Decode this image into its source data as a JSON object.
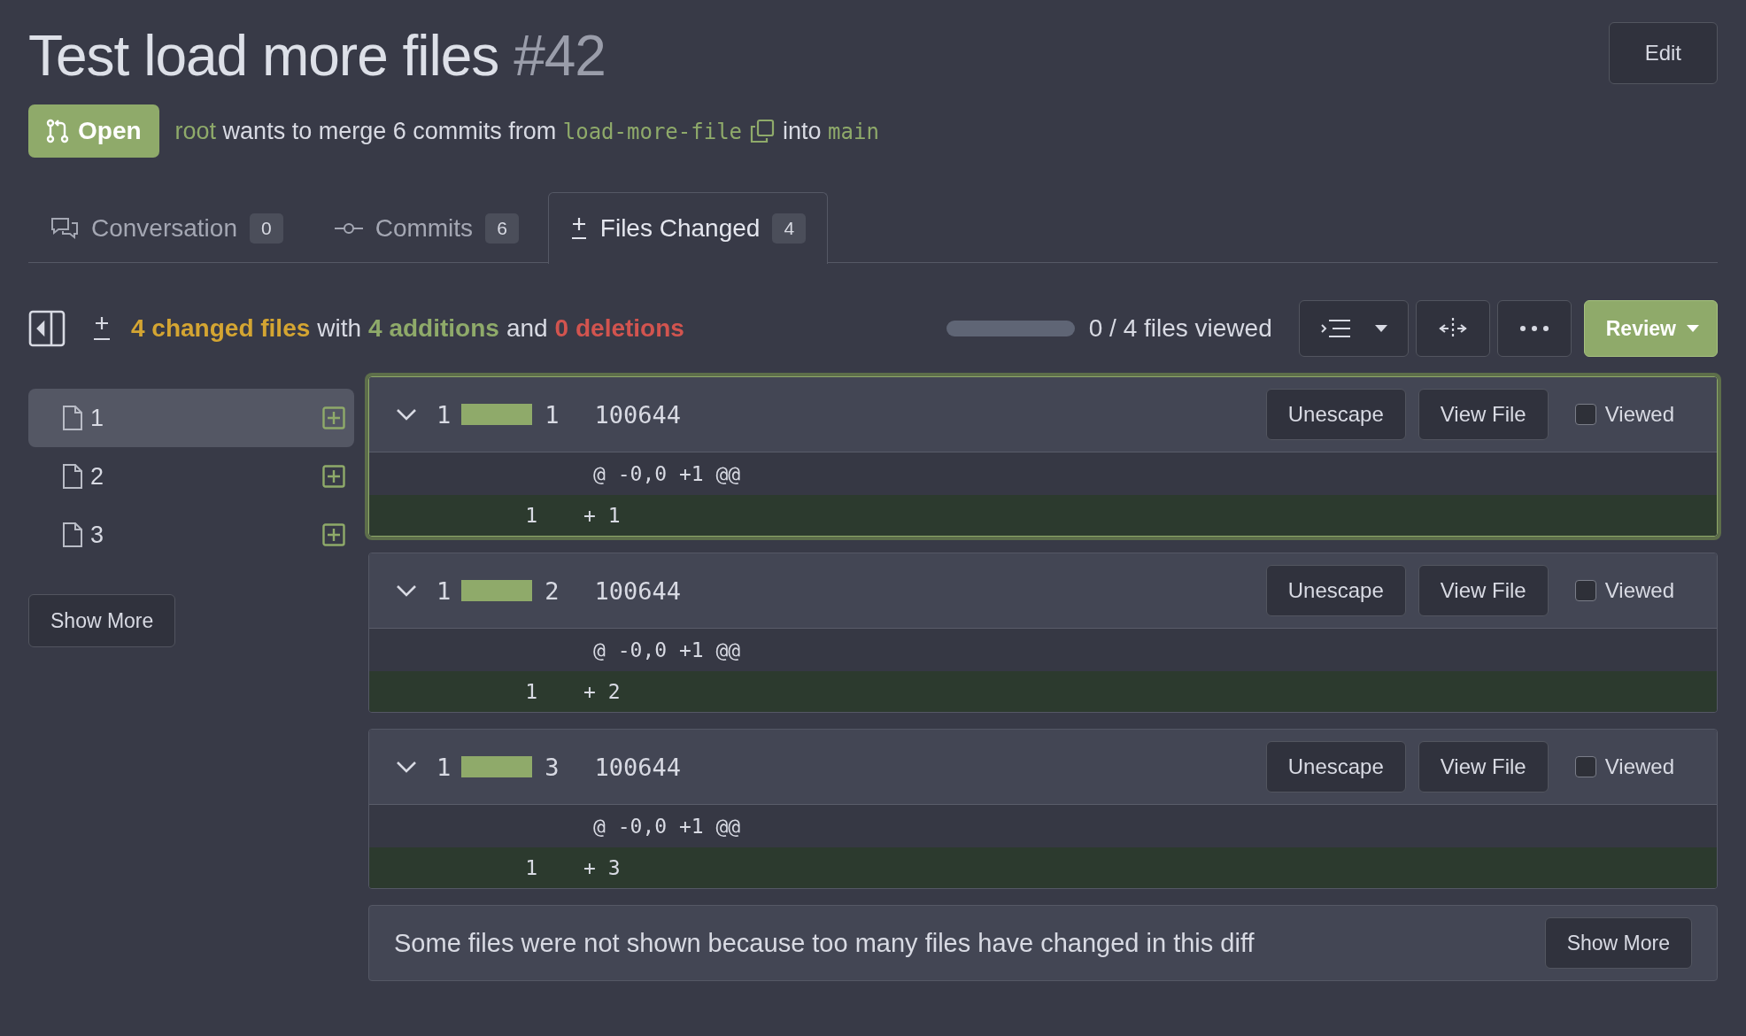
{
  "title": {
    "text": "Test load more files",
    "number": "#42"
  },
  "edit_button": "Edit",
  "status": {
    "label": "Open",
    "author": "root",
    "text_before": "wants to merge 6 commits from",
    "head_branch": "load-more-file",
    "text_middle": "into",
    "base_branch": "main"
  },
  "tabs": [
    {
      "kind": "conversation",
      "label": "Conversation",
      "count": "0",
      "selected": false
    },
    {
      "kind": "commits",
      "label": "Commits",
      "count": "6",
      "selected": false
    },
    {
      "kind": "files",
      "label": "Files Changed",
      "count": "4",
      "selected": true
    }
  ],
  "summary": {
    "files": "4 changed files",
    "with": "with",
    "additions": "4 additions",
    "and": "and",
    "deletions": "0 deletions"
  },
  "viewed": {
    "level": 0,
    "text": "0 / 4 files viewed"
  },
  "review_button": "Review",
  "file_tree": [
    {
      "name": "1",
      "selected": true
    },
    {
      "name": "2",
      "selected": false
    },
    {
      "name": "3",
      "selected": false
    }
  ],
  "sidebar_show_more": "Show More",
  "diffs": [
    {
      "additions": "1",
      "name": "1",
      "mode": "100644",
      "active": true,
      "unescape": "Unescape",
      "view_file": "View File",
      "viewed_label": "Viewed",
      "viewed": false,
      "hunk": "@ -0,0 +1 @@",
      "line_number": "1",
      "line": "+ 1"
    },
    {
      "additions": "1",
      "name": "2",
      "mode": "100644",
      "active": false,
      "unescape": "Unescape",
      "view_file": "View File",
      "viewed_label": "Viewed",
      "viewed": false,
      "hunk": "@ -0,0 +1 @@",
      "line_number": "1",
      "line": "+ 2"
    },
    {
      "additions": "1",
      "name": "3",
      "mode": "100644",
      "active": false,
      "unescape": "Unescape",
      "view_file": "View File",
      "viewed_label": "Viewed",
      "viewed": false,
      "hunk": "@ -0,0 +1 @@",
      "line_number": "1",
      "line": "+ 3"
    }
  ],
  "notice": {
    "text": "Some files were not shown because too many files have changed in this diff",
    "button": "Show More"
  }
}
